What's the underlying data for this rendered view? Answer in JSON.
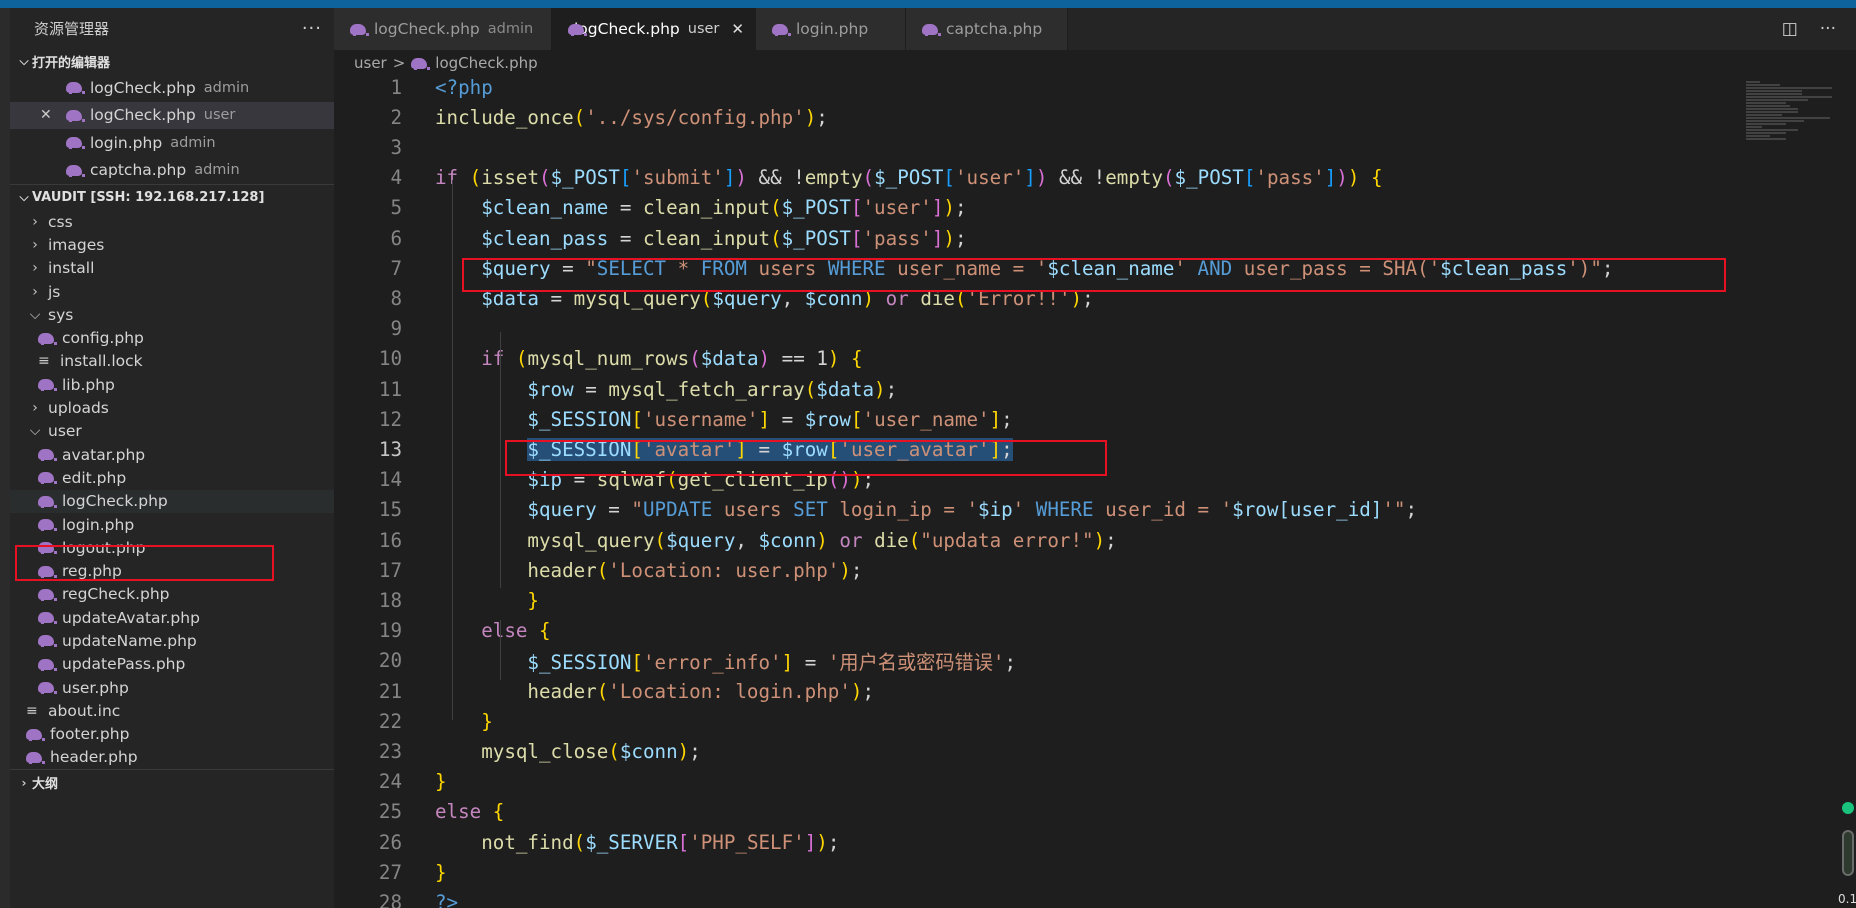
{
  "explorer": {
    "title": "资源管理器",
    "more": "···",
    "open_editors_title": "打开的编辑器",
    "open_editors": [
      {
        "name": "logCheck.php",
        "folder": "admin"
      },
      {
        "name": "logCheck.php",
        "folder": "user"
      },
      {
        "name": "login.php",
        "folder": "admin"
      },
      {
        "name": "captcha.php",
        "folder": "admin"
      }
    ],
    "workspace_title": "VAUDIT [SSH: 192.168.217.128]",
    "tree": [
      {
        "label": "css",
        "kind": "folder-closed",
        "level": 1
      },
      {
        "label": "images",
        "kind": "folder-closed",
        "level": 1
      },
      {
        "label": "install",
        "kind": "folder-closed",
        "level": 1
      },
      {
        "label": "js",
        "kind": "folder-closed",
        "level": 1
      },
      {
        "label": "sys",
        "kind": "folder-open",
        "level": 1
      },
      {
        "label": "config.php",
        "kind": "php",
        "level": 2
      },
      {
        "label": "install.lock",
        "kind": "txt",
        "level": 2
      },
      {
        "label": "lib.php",
        "kind": "php",
        "level": 2
      },
      {
        "label": "uploads",
        "kind": "folder-closed",
        "level": 1
      },
      {
        "label": "user",
        "kind": "folder-open",
        "level": 1
      },
      {
        "label": "avatar.php",
        "kind": "php",
        "level": 2
      },
      {
        "label": "edit.php",
        "kind": "php",
        "level": 2
      },
      {
        "label": "logCheck.php",
        "kind": "php",
        "level": 2
      },
      {
        "label": "login.php",
        "kind": "php",
        "level": 2
      },
      {
        "label": "logout.php",
        "kind": "php",
        "level": 2
      },
      {
        "label": "reg.php",
        "kind": "php",
        "level": 2
      },
      {
        "label": "regCheck.php",
        "kind": "php",
        "level": 2
      },
      {
        "label": "updateAvatar.php",
        "kind": "php",
        "level": 2
      },
      {
        "label": "updateName.php",
        "kind": "php",
        "level": 2
      },
      {
        "label": "updatePass.php",
        "kind": "php",
        "level": 2
      },
      {
        "label": "user.php",
        "kind": "php",
        "level": 2
      },
      {
        "label": "about.inc",
        "kind": "txt",
        "level": 1
      },
      {
        "label": "footer.php",
        "kind": "php",
        "level": 1
      },
      {
        "label": "header.php",
        "kind": "php",
        "level": 1
      }
    ],
    "outline_title": "大纲"
  },
  "tabs": [
    {
      "name": "logCheck.php",
      "folder": "admin",
      "active": false
    },
    {
      "name": "logCheck.php",
      "folder": "user",
      "active": true,
      "close": "✕"
    },
    {
      "name": "login.php",
      "folder": "",
      "active": false
    },
    {
      "name": "captcha.php",
      "folder": "",
      "active": false
    }
  ],
  "breadcrumb": {
    "folder": "user",
    "sep": ">",
    "file": "logCheck.php"
  },
  "editor": {
    "current_line": 13,
    "lines": [
      {
        "n": "1",
        "code": "<?php"
      },
      {
        "n": "2",
        "code": "include_once('../sys/config.php');"
      },
      {
        "n": "3",
        "code": ""
      },
      {
        "n": "4",
        "code": "if (isset($_POST['submit']) && !empty($_POST['user']) && !empty($_POST['pass'])) {"
      },
      {
        "n": "5",
        "code": "    $clean_name = clean_input($_POST['user']);"
      },
      {
        "n": "6",
        "code": "    $clean_pass = clean_input($_POST['pass']);"
      },
      {
        "n": "7",
        "code": "    $query = \"SELECT * FROM users WHERE user_name = '$clean_name' AND user_pass = SHA('$clean_pass')\";"
      },
      {
        "n": "8",
        "code": "    $data = mysql_query($query, $conn) or die('Error!!');"
      },
      {
        "n": "9",
        "code": ""
      },
      {
        "n": "10",
        "code": "    if (mysql_num_rows($data) == 1) {"
      },
      {
        "n": "11",
        "code": "        $row = mysql_fetch_array($data);"
      },
      {
        "n": "12",
        "code": "        $_SESSION['username'] = $row['user_name'];"
      },
      {
        "n": "13",
        "code": "        $_SESSION['avatar'] = $row['user_avatar'];"
      },
      {
        "n": "14",
        "code": "        $ip = sqlwaf(get_client_ip());"
      },
      {
        "n": "15",
        "code": "        $query = \"UPDATE users SET login_ip = '$ip' WHERE user_id = '$row[user_id]'\";"
      },
      {
        "n": "16",
        "code": "        mysql_query($query, $conn) or die(\"updata error!\");"
      },
      {
        "n": "17",
        "code": "        header('Location: user.php');"
      },
      {
        "n": "18",
        "code": "        }"
      },
      {
        "n": "19",
        "code": "    else {"
      },
      {
        "n": "20",
        "code": "        $_SESSION['error_info'] = '用户名或密码错误';"
      },
      {
        "n": "21",
        "code": "        header('Location: login.php');"
      },
      {
        "n": "22",
        "code": "    }"
      },
      {
        "n": "23",
        "code": "    mysql_close($conn);"
      },
      {
        "n": "24",
        "code": "}"
      },
      {
        "n": "25",
        "code": "else {"
      },
      {
        "n": "26",
        "code": "    not_find($_SERVER['PHP_SELF']);"
      },
      {
        "n": "27",
        "code": "}"
      },
      {
        "n": "28",
        "code": "?>"
      }
    ]
  },
  "status_mini": "0.1",
  "colors": {
    "accent": "#0e639c",
    "highlight_box": "#e81123",
    "php_icon": "#a074c4"
  }
}
